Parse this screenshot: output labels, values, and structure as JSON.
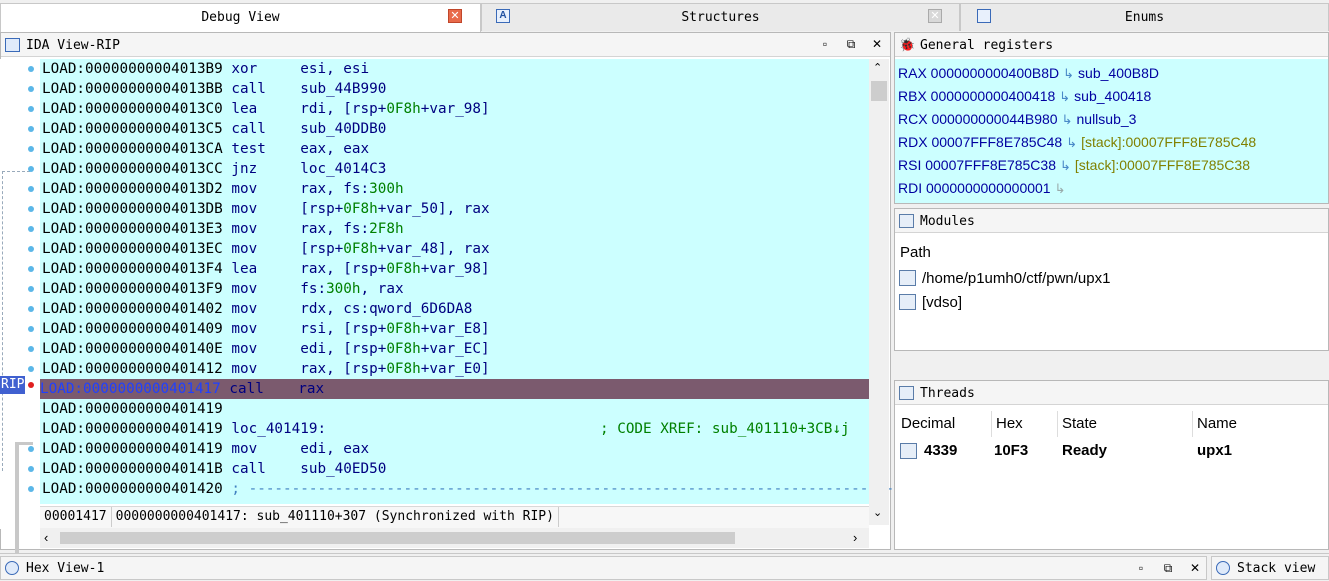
{
  "tabs": [
    {
      "label": "Debug View"
    },
    {
      "label": "Structures"
    },
    {
      "label": "Enums"
    }
  ],
  "ida_view": {
    "title": "IDA View-RIP",
    "rip_marker": "RIP",
    "lines": [
      {
        "seg": "LOAD:",
        "addr": "00000000004013B9",
        "mn": "xor",
        "op": "esi, esi"
      },
      {
        "seg": "LOAD:",
        "addr": "00000000004013BB",
        "mn": "call",
        "op": "sub_44B990"
      },
      {
        "seg": "LOAD:",
        "addr": "00000000004013C0",
        "mn": "lea",
        "op": "rdi, [rsp+0F8h+var_98]"
      },
      {
        "seg": "LOAD:",
        "addr": "00000000004013C5",
        "mn": "call",
        "op": "sub_40DDB0"
      },
      {
        "seg": "LOAD:",
        "addr": "00000000004013CA",
        "mn": "test",
        "op": "eax, eax"
      },
      {
        "seg": "LOAD:",
        "addr": "00000000004013CC",
        "mn": "jnz",
        "op": "loc_4014C3"
      },
      {
        "seg": "LOAD:",
        "addr": "00000000004013D2",
        "mn": "mov",
        "op": "rax, fs:300h"
      },
      {
        "seg": "LOAD:",
        "addr": "00000000004013DB",
        "mn": "mov",
        "op": "[rsp+0F8h+var_50], rax"
      },
      {
        "seg": "LOAD:",
        "addr": "00000000004013E3",
        "mn": "mov",
        "op": "rax, fs:2F8h"
      },
      {
        "seg": "LOAD:",
        "addr": "00000000004013EC",
        "mn": "mov",
        "op": "[rsp+0F8h+var_48], rax"
      },
      {
        "seg": "LOAD:",
        "addr": "00000000004013F4",
        "mn": "lea",
        "op": "rax, [rsp+0F8h+var_98]"
      },
      {
        "seg": "LOAD:",
        "addr": "00000000004013F9",
        "mn": "mov",
        "op": "fs:300h, rax"
      },
      {
        "seg": "LOAD:",
        "addr": "0000000000401402",
        "mn": "mov",
        "op": "rdx, cs:qword_6D6DA8"
      },
      {
        "seg": "LOAD:",
        "addr": "0000000000401409",
        "mn": "mov",
        "op": "rsi, [rsp+0F8h+var_E8]"
      },
      {
        "seg": "LOAD:",
        "addr": "000000000040140E",
        "mn": "mov",
        "op": "edi, [rsp+0F8h+var_EC]"
      },
      {
        "seg": "LOAD:",
        "addr": "0000000000401412",
        "mn": "mov",
        "op": "rax, [rsp+0F8h+var_E0]"
      },
      {
        "seg": "LOAD:",
        "addr": "0000000000401417",
        "mn": "call",
        "op": "rax"
      },
      {
        "seg": "LOAD:",
        "addr": "0000000000401419",
        "mn": "",
        "op": ""
      },
      {
        "seg": "LOAD:",
        "addr": "0000000000401419",
        "mn": "loc_401419:",
        "op": ""
      },
      {
        "seg": "LOAD:",
        "addr": "0000000000401419",
        "mn": "mov",
        "op": "edi, eax"
      },
      {
        "seg": "LOAD:",
        "addr": "000000000040141B",
        "mn": "call",
        "op": "sub_40ED50"
      },
      {
        "seg": "LOAD:",
        "addr": "0000000000401420",
        "mn": "; ---------------------------------------------------------------------------",
        "op": ""
      }
    ],
    "xref_comment": "; CODE XREF: sub_401110+3CB↓j",
    "status_offset": "00001417",
    "status_text": "0000000000401417: sub_401110+307 (Synchronized with RIP)"
  },
  "registers": {
    "title": "General registers",
    "rows": [
      {
        "name": "RAX",
        "value": "0000000000400B8D",
        "symbol": "sub_400B8D",
        "stack": false
      },
      {
        "name": "RBX",
        "value": "0000000000400418",
        "symbol": "sub_400418",
        "stack": false
      },
      {
        "name": "RCX",
        "value": "000000000044B980",
        "symbol": "nullsub_3",
        "stack": false
      },
      {
        "name": "RDX",
        "value": "00007FFF8E785C48",
        "symbol": "[stack]:00007FFF8E785C48",
        "stack": true
      },
      {
        "name": "RSI",
        "value": "00007FFF8E785C38",
        "symbol": "[stack]:00007FFF8E785C38",
        "stack": true
      },
      {
        "name": "RDI",
        "value": "0000000000000001",
        "symbol": "",
        "stack": false
      }
    ]
  },
  "modules": {
    "title": "Modules",
    "header": "Path",
    "items": [
      "/home/p1umh0/ctf/pwn/upx1",
      "[vdso]"
    ]
  },
  "threads": {
    "title": "Threads",
    "columns": [
      "Decimal",
      "Hex",
      "State",
      "Name"
    ],
    "rows": [
      {
        "decimal": "4339",
        "hex": "10F3",
        "state": "Ready",
        "name": "upx1"
      }
    ]
  },
  "bottom": {
    "hex_view": "Hex View-1",
    "stack_view": "Stack view"
  },
  "colors": {
    "disasm_bg": "#ccffff",
    "current_line": "#7b5a6e",
    "mnemonic": "#000080",
    "number": "#008000"
  }
}
